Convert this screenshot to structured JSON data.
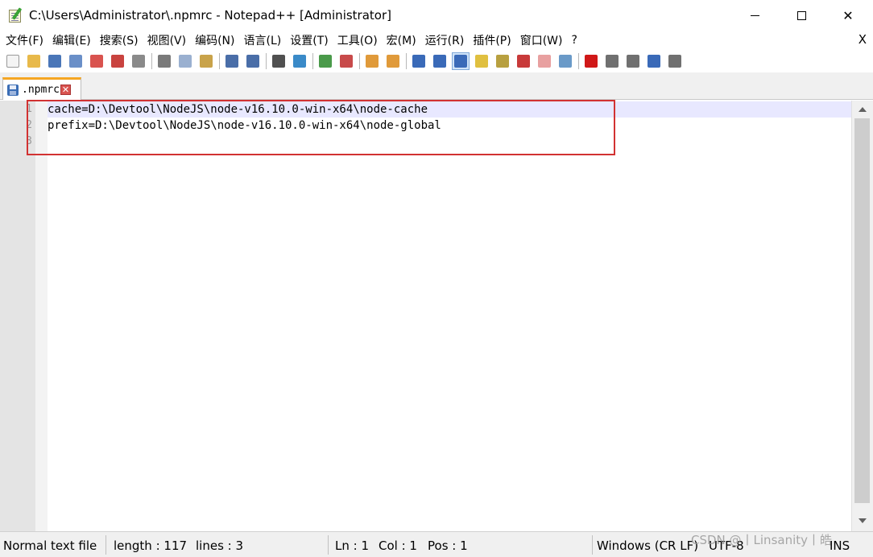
{
  "window": {
    "title": "C:\\Users\\Administrator\\.npmrc - Notepad++ [Administrator]",
    "minimize_label": "",
    "close_label": "✕"
  },
  "menubar": {
    "items": [
      "文件(F)",
      "编辑(E)",
      "搜索(S)",
      "视图(V)",
      "编码(N)",
      "语言(L)",
      "设置(T)",
      "工具(O)",
      "宏(M)",
      "运行(R)",
      "插件(P)",
      "窗口(W)",
      "?"
    ],
    "close_label": "X"
  },
  "toolbar": {
    "icons": [
      "new-file-icon",
      "open-file-icon",
      "save-icon",
      "save-all-icon",
      "close-icon",
      "close-all-icon",
      "print-icon",
      "|",
      "cut-icon",
      "copy-icon",
      "paste-icon",
      "|",
      "undo-icon",
      "redo-icon",
      "|",
      "find-icon",
      "replace-icon",
      "|",
      "zoom-in-icon",
      "zoom-out-icon",
      "|",
      "sync-vertical-icon",
      "sync-horizontal-icon",
      "|",
      "word-wrap-icon",
      "show-all-characters-icon",
      "indent-guide-icon",
      "user-defined-language-icon",
      "document-map-icon",
      "function-list-icon",
      "folder-as-workspace-icon",
      "monitoring-icon",
      "|",
      "record-macro-icon",
      "stop-recording-icon",
      "playback-macro-icon",
      "run-macro-multiple-icon",
      "save-macro-icon"
    ],
    "colors": {
      "new-file-icon": "#f4f4f4",
      "open-file-icon": "#e8b94a",
      "save-icon": "#4a76b8",
      "save-all-icon": "#6a8fc8",
      "close-icon": "#d9534f",
      "close-all-icon": "#c9433f",
      "print-icon": "#8a8a8a",
      "cut-icon": "#7a7a7a",
      "copy-icon": "#9ab0d0",
      "paste-icon": "#c9a34a",
      "undo-icon": "#4a6ea8",
      "redo-icon": "#4a6ea8",
      "find-icon": "#505050",
      "replace-icon": "#3a8ac8",
      "zoom-in-icon": "#4a9a4a",
      "zoom-out-icon": "#c84a4a",
      "sync-vertical-icon": "#e09a3a",
      "sync-horizontal-icon": "#e09a3a",
      "word-wrap-icon": "#3a6ab8",
      "show-all-characters-icon": "#3a6ab8",
      "indent-guide-icon": "#3a6ab8",
      "user-defined-language-icon": "#e0c040",
      "document-map-icon": "#b8a040",
      "function-list-icon": "#c83a3a",
      "folder-as-workspace-icon": "#e8a0a0",
      "monitoring-icon": "#6a9ac8",
      "record-macro-icon": "#d01818",
      "stop-recording-icon": "#707070",
      "playback-macro-icon": "#707070",
      "run-macro-multiple-icon": "#3a6ab8",
      "save-macro-icon": "#707070"
    },
    "active_icon": "indent-guide-icon"
  },
  "tab": {
    "label": ".npmrc",
    "close_label": "✕"
  },
  "editor": {
    "line_numbers": [
      "1",
      "2",
      "3"
    ],
    "lines": [
      "cache=D:\\Devtool\\NodeJS\\node-v16.10.0-win-x64\\node-cache",
      "prefix=D:\\Devtool\\NodeJS\\node-v16.10.0-win-x64\\node-global",
      ""
    ],
    "current_line": 1
  },
  "statusbar": {
    "file_type": "Normal text file",
    "length": "length : 117",
    "lines": "lines : 3",
    "ln": "Ln : 1",
    "col": "Col : 1",
    "pos": "Pos : 1",
    "eol": "Windows (CR LF)",
    "encoding": "UTF-8",
    "mode": "INS"
  },
  "watermark": "CSDN @丨Linsanity丨皓"
}
